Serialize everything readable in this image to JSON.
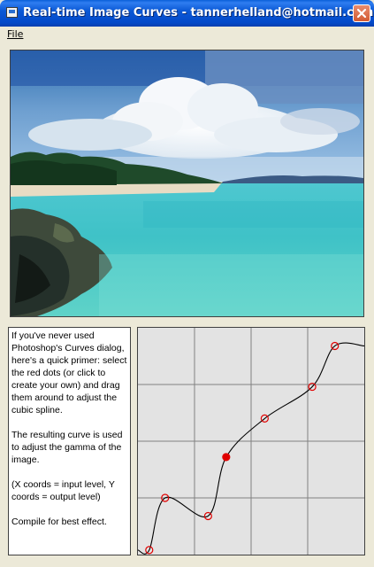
{
  "window": {
    "title": "Real-time Image Curves - tannerhelland@hotmail.com",
    "close_icon": "close-icon",
    "app_icon": "app-icon"
  },
  "menu": {
    "items": [
      {
        "label": "File"
      }
    ]
  },
  "image": {
    "description_icon": "beach-photo"
  },
  "help": {
    "paragraphs": [
      "If you've never used Photoshop's Curves dialog, here's a quick primer: select the red dots (or click to create your own) and drag them around to adjust the cubic spline.",
      "The resulting curve is used to adjust the gamma of the image.",
      "(X coords = input level, Y coords = output level)",
      "Compile for best effect."
    ]
  },
  "curve": {
    "colors": {
      "background": "#e3e3e3",
      "grid": "#808080",
      "point": "#e00000",
      "selected_point": "#e00000",
      "curve": "#000000"
    },
    "grid_divisions": 4,
    "points": [
      {
        "x": 0.05,
        "y": 0.02,
        "selected": false
      },
      {
        "x": 0.12,
        "y": 0.25,
        "selected": false
      },
      {
        "x": 0.31,
        "y": 0.17,
        "selected": false
      },
      {
        "x": 0.39,
        "y": 0.43,
        "selected": true
      },
      {
        "x": 0.56,
        "y": 0.6,
        "selected": false
      },
      {
        "x": 0.77,
        "y": 0.74,
        "selected": false
      },
      {
        "x": 0.87,
        "y": 0.92,
        "selected": false
      }
    ]
  }
}
